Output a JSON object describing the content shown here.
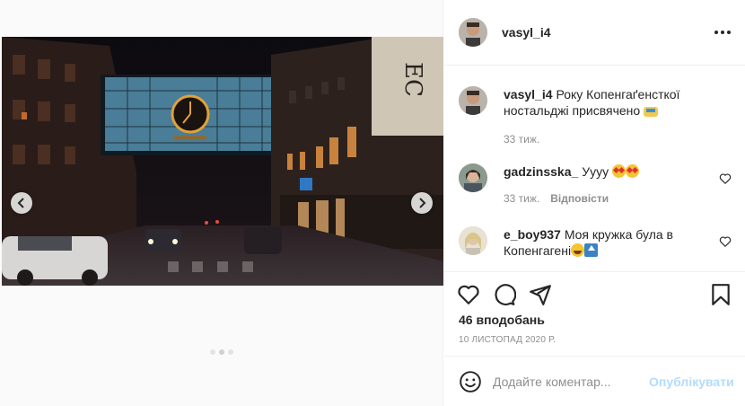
{
  "post": {
    "author": "vasyl_i4",
    "caption": "Року Копенгаґенсткої ностальджі присвячено",
    "caption_emoji": "car-emoji",
    "caption_time": "33 тиж.",
    "likes": "46 вподобань",
    "date": "10 ЛИСТОПАД 2020 Р.",
    "photo_sign": "EC",
    "slides_total": 3,
    "slide_active": 2
  },
  "comments": [
    {
      "username": "gadzinsska_",
      "text": "Уууу",
      "emojis": [
        "star-struck-emoji",
        "star-struck-emoji"
      ],
      "time": "33 тиж.",
      "reply_label": "Відповісти"
    },
    {
      "username": "e_boy937",
      "text": "Моя кружка була в Копенгагені",
      "emojis": [
        "joy-emoji",
        "top-emoji"
      ]
    }
  ],
  "add_comment": {
    "placeholder": "Додайте коментар...",
    "publish_label": "Опублікувати"
  },
  "colors": {
    "publish_disabled": "#b3dbff",
    "secondary_text": "#8e8e8e",
    "border": "#efefef"
  }
}
